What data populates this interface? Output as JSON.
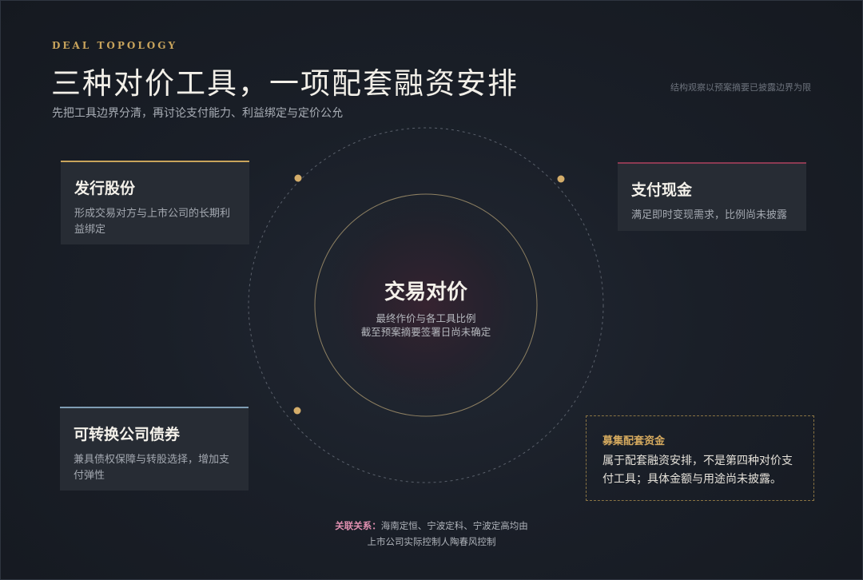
{
  "header": {
    "eyebrow": "DEAL TOPOLOGY",
    "title": "三种对价工具，一项配套融资安排",
    "subtitle": "先把工具边界分清，再讨论支付能力、利益绑定与定价公允",
    "note": "结构观察以预案摘要已披露边界为限"
  },
  "center": {
    "title": "交易对价",
    "line1": "最终作价与各工具比例",
    "line2": "截至预案摘要签署日尚未确定"
  },
  "cards": {
    "shares": {
      "title": "发行股份",
      "desc": "形成交易对方与上市公司的长期利益绑定"
    },
    "cash": {
      "title": "支付现金",
      "desc": "满足即时变现需求，比例尚未披露"
    },
    "bonds": {
      "title": "可转换公司债券",
      "desc": "兼具债权保障与转股选择，增加支付弹性"
    }
  },
  "funding": {
    "title": "募集配套资金",
    "desc": "属于配套融资安排，不是第四种对价支付工具；具体金额与用途尚未披露。"
  },
  "relation": {
    "label": "关联关系：",
    "line1": "海南定恒、宁波定科、宁波定高均由",
    "line2": "上市公司实际控制人陶春风控制"
  },
  "colors": {
    "gold": "#c9a45c",
    "crimson": "#8c3a52",
    "steel_blue": "#7f9db4",
    "background": "#1a1f28"
  }
}
